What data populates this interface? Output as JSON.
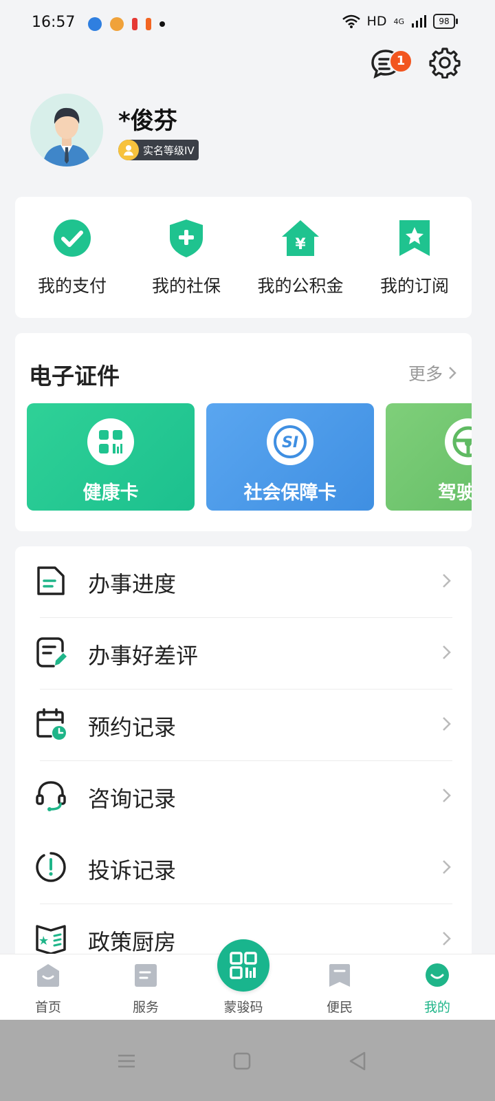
{
  "status_bar": {
    "time": "16:57",
    "network": "HD",
    "signal": "4G",
    "battery": "98"
  },
  "header": {
    "message_badge_count": "1"
  },
  "profile": {
    "name": "*俊芬",
    "level_label": "实名等级IV"
  },
  "quick_actions": [
    {
      "label": "我的支付",
      "icon": "check-circle-icon"
    },
    {
      "label": "我的社保",
      "icon": "shield-plus-icon"
    },
    {
      "label": "我的公积金",
      "icon": "house-yuan-icon"
    },
    {
      "label": "我的订阅",
      "icon": "bookmark-star-icon"
    }
  ],
  "certificates": {
    "title": "电子证件",
    "more_label": "更多",
    "items": [
      {
        "label": "健康卡",
        "icon": "health-qr-icon"
      },
      {
        "label": "社会保障卡",
        "icon": "social-security-icon"
      },
      {
        "label": "驾驶",
        "icon": "steering-wheel-icon"
      }
    ]
  },
  "menu": [
    {
      "label": "办事进度",
      "icon": "document-icon"
    },
    {
      "label": "办事好差评",
      "icon": "review-pen-icon"
    },
    {
      "label": "预约记录",
      "icon": "calendar-clock-icon"
    },
    {
      "label": "咨询记录",
      "icon": "headset-icon"
    },
    {
      "label": "投诉记录",
      "icon": "exclamation-circle-icon"
    },
    {
      "label": "政策厨房",
      "icon": "policy-book-icon"
    }
  ],
  "tabbar": {
    "items": [
      {
        "label": "首页"
      },
      {
        "label": "服务"
      },
      {
        "label": "蒙骏码"
      },
      {
        "label": "便民"
      },
      {
        "label": "我的"
      }
    ],
    "active": "我的"
  },
  "colors": {
    "brand_green": "#1fb589",
    "badge_red": "#f2551f",
    "health_card": "#22c892",
    "social_card": "#4a96e8",
    "driver_card": "#6cc36b"
  }
}
